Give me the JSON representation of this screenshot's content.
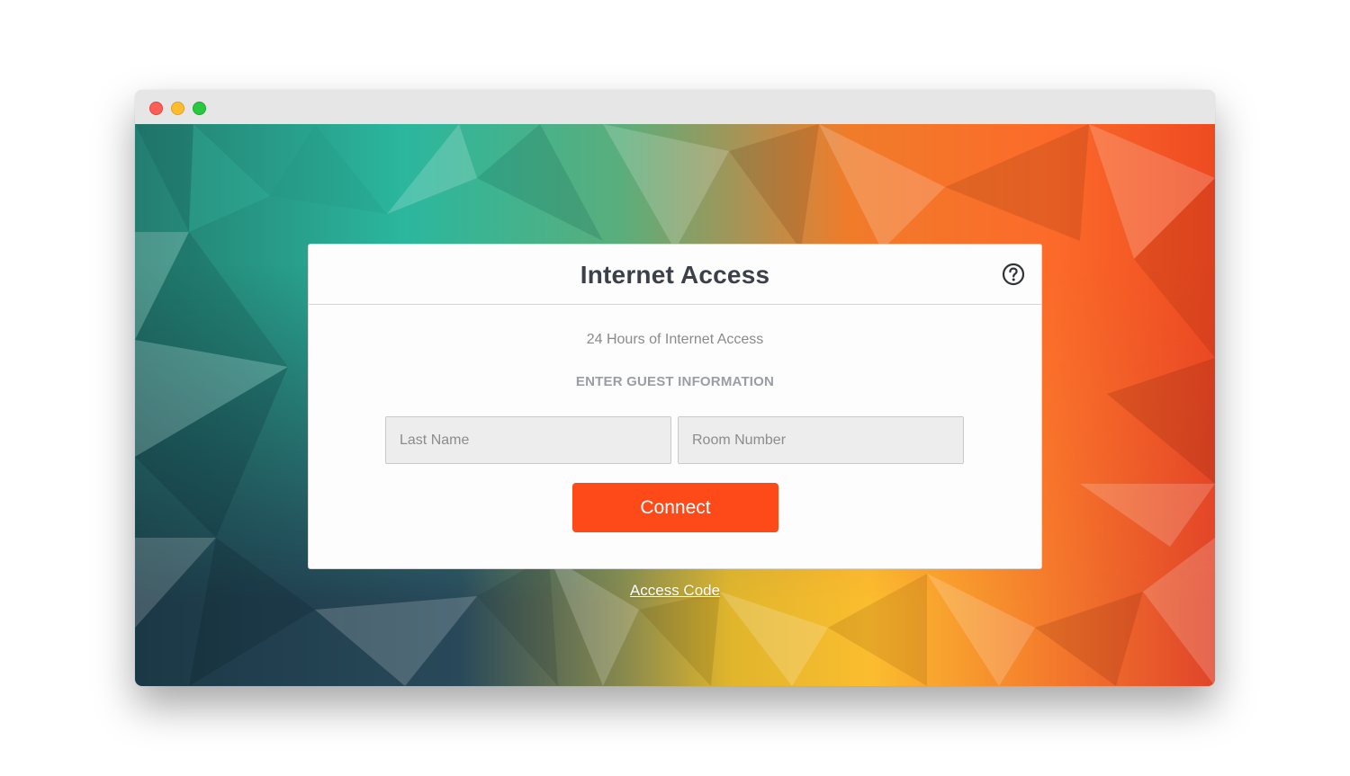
{
  "window": {
    "controls": [
      "close",
      "minimize",
      "zoom"
    ]
  },
  "card": {
    "title": "Internet Access",
    "help_icon": "question-circle-icon",
    "subtitle": "24 Hours of Internet Access",
    "section_label": "ENTER GUEST INFORMATION",
    "last_name": {
      "value": "",
      "placeholder": "Last Name"
    },
    "room_number": {
      "value": "",
      "placeholder": "Room Number"
    },
    "connect_label": "Connect"
  },
  "footer": {
    "access_code_label": "Access Code"
  },
  "colors": {
    "accent": "#fd4a18",
    "title_text": "#3b4049",
    "card_bg": "#fdfdfd",
    "field_bg": "#ededed"
  }
}
